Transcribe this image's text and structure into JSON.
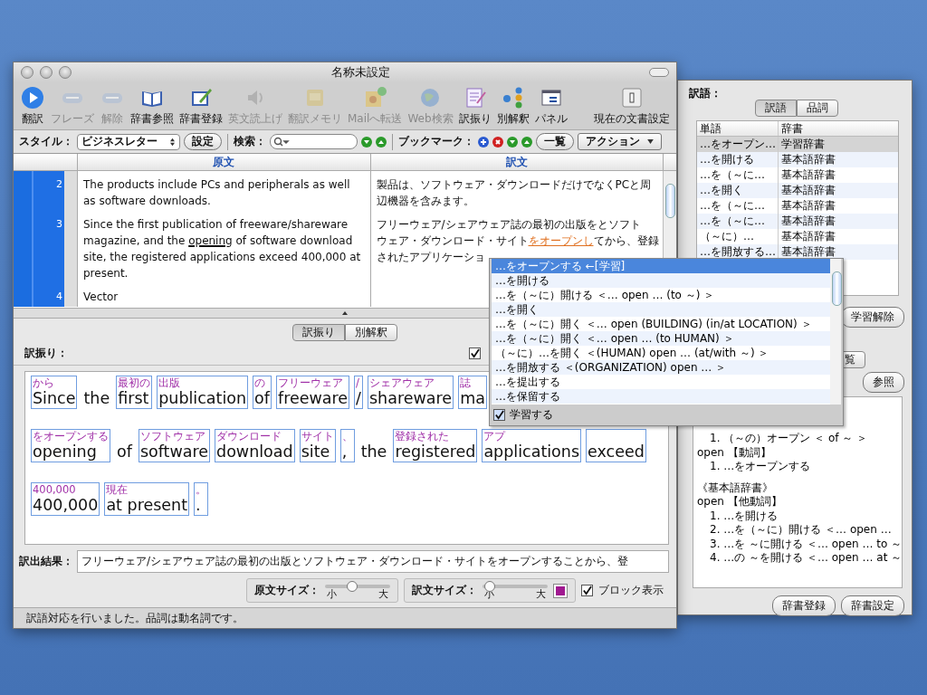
{
  "window": {
    "title": "名称未設定"
  },
  "toolbar": [
    {
      "label": "翻訳",
      "kind": "play",
      "disabled": false
    },
    {
      "label": "フレーズ",
      "kind": "abcd",
      "disabled": true
    },
    {
      "label": "解除",
      "kind": "abcd",
      "disabled": true
    },
    {
      "label": "辞書参照",
      "kind": "book",
      "disabled": false
    },
    {
      "label": "辞書登録",
      "kind": "pen",
      "disabled": false
    },
    {
      "label": "英文読上げ",
      "kind": "speaker",
      "disabled": true
    },
    {
      "label": "翻訳メモリ",
      "kind": "memo",
      "disabled": true
    },
    {
      "label": "Mailへ転送",
      "kind": "mail",
      "disabled": true
    },
    {
      "label": "Web検索",
      "kind": "globe",
      "disabled": true
    },
    {
      "label": "訳振り",
      "kind": "pad",
      "disabled": false
    },
    {
      "label": "別解釈",
      "kind": "dots",
      "disabled": false
    },
    {
      "label": "パネル",
      "kind": "panel",
      "disabled": false
    },
    {
      "label": "現在の文書設定",
      "kind": "switch",
      "disabled": false
    }
  ],
  "stylebar": {
    "style_label": "スタイル：",
    "style_value": "ビジネスレター",
    "settings_button": "設定",
    "search_label": "検索：",
    "bookmark_label": "ブックマーク：",
    "list_button": "一覧",
    "action_button": "アクション"
  },
  "editor": {
    "columns": [
      "原文",
      "訳文"
    ],
    "rows": [
      {
        "number": "2",
        "source": [
          {
            "text": "The products include PCs and peripherals as well as software downloads.",
            "underline": false
          }
        ],
        "target": [
          [
            {
              "text": "製品は、ソフトウェア・ダウンロードだけでなくPCと周",
              "highlight": false
            }
          ],
          [
            {
              "text": "辺機器を含みます。",
              "highlight": false
            }
          ]
        ]
      },
      {
        "number": "3",
        "source": [
          {
            "text": "Since the first publication of freeware/shareware magazine, and the ",
            "underline": false
          },
          {
            "text": "opening",
            "underline": true
          },
          {
            "text": " of software download site, the registered applications exceed 400,000 at present.",
            "underline": false
          }
        ],
        "target": [
          [
            {
              "text": "フリーウェア/シェアウェア誌の最初の出版をとソフト",
              "highlight": false
            }
          ],
          [
            {
              "text": "ウェア・ダウンロード・サイト",
              "highlight": false
            },
            {
              "text": "をオープンし",
              "highlight": true
            },
            {
              "text": "てから、登録",
              "highlight": false
            }
          ],
          [
            {
              "text": "されたアプリケーショ",
              "highlight": false
            }
          ]
        ]
      },
      {
        "number": "4",
        "source": [
          {
            "text": "Vector",
            "underline": false
          }
        ],
        "target": []
      }
    ]
  },
  "view_tabs": [
    {
      "label": "訳振り",
      "selected": true
    },
    {
      "label": "別解釈",
      "selected": false
    }
  ],
  "alignment": {
    "label": "訳振り：",
    "checked": true,
    "lines": [
      [
        {
          "gloss": "から",
          "word": "Since",
          "boxed": true
        },
        {
          "word": "the",
          "boxed": false
        },
        {
          "gloss": "最初の",
          "word": "first",
          "boxed": true
        },
        {
          "gloss": "出版",
          "word": "publication",
          "boxed": true
        },
        {
          "gloss": "の",
          "word": "of",
          "boxed": true
        },
        {
          "gloss": "フリーウェア",
          "word": "freeware",
          "boxed": true
        },
        {
          "gloss": "/",
          "word": "/",
          "boxed": true
        },
        {
          "gloss": "シェアウェア",
          "word": "shareware",
          "boxed": true
        },
        {
          "gloss": "誌",
          "word": "ma",
          "boxed": true
        }
      ],
      [
        {
          "gloss": "をオープンする",
          "word": "opening",
          "boxed": true
        },
        {
          "word": "of",
          "boxed": false
        },
        {
          "gloss": "ソフトウェア",
          "word": "software",
          "boxed": true
        },
        {
          "gloss": "ダウンロード",
          "word": "download",
          "boxed": true
        },
        {
          "gloss": "サイト",
          "word": "site",
          "boxed": true
        },
        {
          "gloss": "、",
          "word": ",",
          "boxed": true
        },
        {
          "word": "the",
          "boxed": false
        },
        {
          "gloss": "登録された",
          "word": "registered",
          "boxed": true
        },
        {
          "gloss": "アプ",
          "word": "applications",
          "boxed": true
        },
        {
          "word": "exceed",
          "boxed": true
        }
      ],
      [
        {
          "gloss": "400,000",
          "word": "400,000",
          "boxed": true
        },
        {
          "gloss": "現在",
          "word": "at present",
          "boxed": true
        },
        {
          "gloss": "。",
          "word": ".",
          "boxed": true
        }
      ]
    ]
  },
  "result": {
    "label": "訳出結果：",
    "value": "フリーウェア/シェアウェア誌の最初の出版とソフトウェア・ダウンロード・サイトをオープンすることから、登"
  },
  "sizes": [
    {
      "label": "原文サイズ：",
      "small": "小",
      "large": "大",
      "level": 0.4
    },
    {
      "label": "訳文サイズ：",
      "small": "小",
      "large": "大",
      "level": 0.1
    }
  ],
  "text_color": {
    "color": "#a01890"
  },
  "block_view": {
    "label": "ブロック表示",
    "checked": true
  },
  "status_bar": "訳語対応を行いました。品詞は動名詞です。",
  "popup": {
    "items": [
      {
        "text": "…をオープンする ←[学習]",
        "selected": true
      },
      {
        "text": "…を開ける",
        "selected": false
      },
      {
        "text": "…を（～に）開ける ＜… open … (to ～) ＞",
        "selected": false
      },
      {
        "text": "…を開く",
        "selected": false
      },
      {
        "text": "…を（～に）開く ＜… open (BUILDING) (in/at LOCATION) ＞",
        "selected": false
      },
      {
        "text": "…を（～に）開く ＜… open … (to HUMAN) ＞",
        "selected": false
      },
      {
        "text": "（～に）…を開く ＜(HUMAN) open … (at/with ～) ＞",
        "selected": false
      },
      {
        "text": "…を開放する ＜(ORGANIZATION) open … ＞",
        "selected": false
      },
      {
        "text": "…を提出する",
        "selected": false
      },
      {
        "text": "…を保留する",
        "selected": false
      }
    ],
    "learn": {
      "label": "学習する",
      "checked": true
    }
  },
  "panel": {
    "label": "訳語：",
    "tabs": [
      {
        "label": "訳語",
        "selected": true
      },
      {
        "label": "品詞",
        "selected": false
      }
    ],
    "columns": [
      "単語",
      "辞書"
    ],
    "rows": [
      {
        "word": "…をオープン…",
        "dict": "学習辞書",
        "selected": true
      },
      {
        "word": "…を開ける",
        "dict": "基本語辞書",
        "selected": false
      },
      {
        "word": "…を（～に…",
        "dict": "基本語辞書",
        "selected": false
      },
      {
        "word": "…を開く",
        "dict": "基本語辞書",
        "selected": false
      },
      {
        "word": "…を（～に…",
        "dict": "基本語辞書",
        "selected": false
      },
      {
        "word": "…を（～に…",
        "dict": "基本語辞書",
        "selected": false
      },
      {
        "word": "（～に）…",
        "dict": "基本語辞書",
        "selected": false
      },
      {
        "word": "…を開放する…",
        "dict": "基本語辞書",
        "selected": false
      }
    ],
    "unlearn_button": "学習解除",
    "partial_tab": "覧",
    "refer_button": "参照",
    "dictionary": [
      {
        "senses": [
          "1. （～の）オープン ＜ of ～ ＞"
        ]
      },
      {
        "head": "open 【動詞】",
        "senses": [
          "1. …をオープンする"
        ]
      },
      {
        "source": "《基本語辞書》",
        "head": "open 【他動詞】",
        "senses": [
          "1. …を開ける",
          "2. …を（～に）開ける ＜… open …",
          "3. …を ～に開ける ＜… open … to ～",
          "4. …の ～を開ける ＜… open … at ～"
        ]
      }
    ],
    "buttons": [
      "辞書登録",
      "辞書設定"
    ]
  }
}
